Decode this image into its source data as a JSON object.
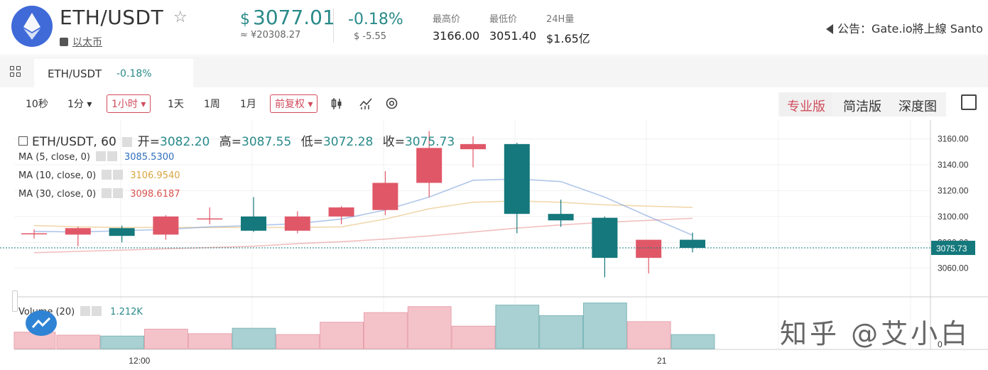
{
  "header": {
    "pair": "ETH/USDT",
    "coin_name": "以太币",
    "price": "3077.01",
    "price_currency": "$",
    "price_cny": "≈ ¥20308.27",
    "change_pct": "-0.18%",
    "change_abs": "$ -5.55",
    "stats": [
      {
        "label": "最高价",
        "value": "3166.00"
      },
      {
        "label": "最低价",
        "value": "3051.40"
      },
      {
        "label": "24H量",
        "value": "$1.65亿"
      }
    ],
    "notice": "公告：Gate.io將上線 Santo"
  },
  "tabbar": {
    "active_tab_name": "ETH/USDT",
    "active_tab_change": "-0.18%"
  },
  "toolbar": {
    "intervals": [
      "10秒",
      "1分 ▾",
      "1小时 ▾",
      "1天",
      "1周",
      "1月"
    ],
    "active_interval": "1小时 ▾",
    "adjust": "前复权 ▾",
    "modes": [
      "专业版",
      "简洁版",
      "深度图"
    ],
    "active_mode": "专业版"
  },
  "chart_legend": {
    "title": "ETH/USDT, 60",
    "open_label": "开=",
    "open": "3082.20",
    "high_label": "高=",
    "high": "3087.55",
    "low_label": "低=",
    "low": "3072.28",
    "close_label": "收=",
    "close": "3075.73",
    "ma5": {
      "label": "MA (5, close, 0)",
      "value": "3085.5300",
      "color": "#2f6ebd"
    },
    "ma10": {
      "label": "MA (10, close, 0)",
      "value": "3106.9540",
      "color": "#d9a441"
    },
    "ma30": {
      "label": "MA (30, close, 0)",
      "value": "3098.6187",
      "color": "#d9534f"
    },
    "volume": {
      "label": "Volume (20)",
      "value": "1.212K"
    }
  },
  "watermark_text": "知乎 @艾小白",
  "chart_data": {
    "type": "candlestick",
    "up_color": "#e05868",
    "down_color": "#14787c",
    "y_ticks": [
      3060,
      3080,
      3100,
      3120,
      3140,
      3160
    ],
    "y_tick_labels": [
      "3060.00",
      "3080.00",
      "3100.00",
      "3120.00",
      "3140.00",
      "3160.00"
    ],
    "ylim": [
      3045,
      3168
    ],
    "x_labels": [
      {
        "i": 2.4,
        "label": "12:00"
      },
      {
        "i": 14.3,
        "label": "21"
      }
    ],
    "last_price_label": "3075.73",
    "last_price": 3075.73,
    "candles": [
      {
        "o": 3087.0,
        "h": 3090.0,
        "l": 3083.0,
        "c": 3087.0
      },
      {
        "o": 3086.0,
        "h": 3092.0,
        "l": 3077.0,
        "c": 3091.0
      },
      {
        "o": 3091.0,
        "h": 3093.0,
        "l": 3080.0,
        "c": 3085.0
      },
      {
        "o": 3086.0,
        "h": 3101.0,
        "l": 3082.0,
        "c": 3100.0
      },
      {
        "o": 3098.0,
        "h": 3107.0,
        "l": 3094.0,
        "c": 3098.5
      },
      {
        "o": 3100.0,
        "h": 3115.0,
        "l": 3088.0,
        "c": 3089.0
      },
      {
        "o": 3089.0,
        "h": 3104.0,
        "l": 3087.0,
        "c": 3100.0
      },
      {
        "o": 3100.0,
        "h": 3108.0,
        "l": 3094.0,
        "c": 3107.0
      },
      {
        "o": 3105.0,
        "h": 3135.0,
        "l": 3101.0,
        "c": 3126.0
      },
      {
        "o": 3126.0,
        "h": 3166.0,
        "l": 3115.0,
        "c": 3153.0
      },
      {
        "o": 3152.0,
        "h": 3162.0,
        "l": 3138.0,
        "c": 3156.0
      },
      {
        "o": 3156.0,
        "h": 3157.0,
        "l": 3087.0,
        "c": 3102.0
      },
      {
        "o": 3102.0,
        "h": 3113.0,
        "l": 3092.0,
        "c": 3097.0
      },
      {
        "o": 3099.0,
        "h": 3100.0,
        "l": 3053.0,
        "c": 3068.0
      },
      {
        "o": 3068.0,
        "h": 3082.0,
        "l": 3056.0,
        "c": 3082.0
      },
      {
        "o": 3082.0,
        "h": 3087.55,
        "l": 3072.28,
        "c": 3075.73
      }
    ],
    "ma5": [
      3088.5,
      3088.0,
      3089.0,
      3090.0,
      3092.0,
      3093.0,
      3094.5,
      3098.0,
      3105.0,
      3115.0,
      3128.0,
      3129.0,
      3127.0,
      3115.0,
      3100.0,
      3085.5
    ],
    "ma10": [
      3093.0,
      3092.0,
      3091.5,
      3091.5,
      3091.5,
      3091.5,
      3091.5,
      3092.0,
      3098.0,
      3106.0,
      3111.0,
      3112.0,
      3111.0,
      3109.0,
      3108.0,
      3107.0
    ],
    "ma30": [
      3072.0,
      3073.0,
      3074.0,
      3075.0,
      3076.0,
      3077.0,
      3079.0,
      3080.5,
      3082.5,
      3085.0,
      3088.0,
      3091.0,
      3093.5,
      3095.5,
      3097.0,
      3098.6
    ],
    "volumes": [
      0.55,
      0.45,
      0.42,
      0.65,
      0.5,
      0.68,
      0.47,
      0.88,
      1.2,
      1.4,
      0.75,
      1.45,
      1.1,
      1.52,
      0.9,
      0.47
    ],
    "volume_ylim": [
      0,
      1.7
    ]
  }
}
